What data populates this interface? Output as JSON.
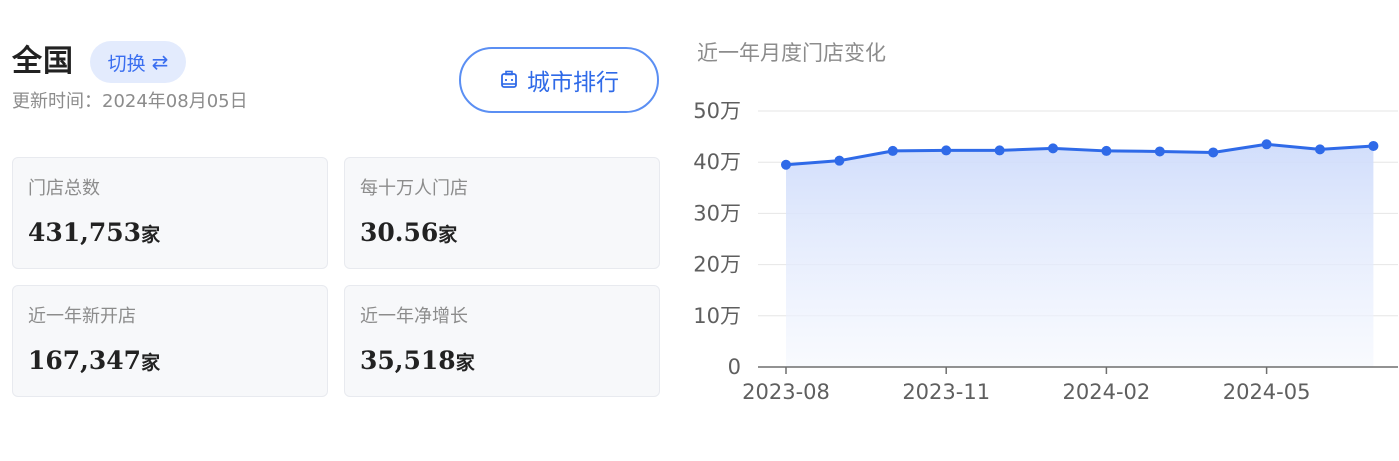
{
  "header": {
    "region": "全国",
    "switch_label": "切换",
    "switch_icon": "⇄",
    "update_text": "更新时间：2024年08月05日",
    "city_rank_label": "城市排行"
  },
  "cards": [
    {
      "label": "门店总数",
      "value": "431,753",
      "unit": "家"
    },
    {
      "label": "每十万人门店",
      "value": "30.56",
      "unit": "家"
    },
    {
      "label": "近一年新开店",
      "value": "167,347",
      "unit": "家"
    },
    {
      "label": "近一年净增长",
      "value": "35,518",
      "unit": "家"
    }
  ],
  "colors": {
    "accent": "#2f6ae8",
    "line": "#2f6ae8",
    "area_top": "#cfdcfb",
    "area_bottom": "#f4f7fe",
    "grid": "#e6e6e6"
  },
  "chart_data": {
    "type": "area",
    "title": "近一年月度门店变化",
    "xlabel": "",
    "ylabel": "",
    "x": [
      "2023-08",
      "2023-09",
      "2023-10",
      "2023-11",
      "2023-12",
      "2024-01",
      "2024-02",
      "2024-03",
      "2024-04",
      "2024-05",
      "2024-06",
      "2024-07"
    ],
    "x_tick_labels": [
      "2023-08",
      "2023-11",
      "2024-02",
      "2024-05"
    ],
    "y_tick_labels": [
      "0",
      "10万",
      "20万",
      "30万",
      "40万",
      "50万"
    ],
    "ylim": [
      0,
      500000
    ],
    "grid": true,
    "series": [
      {
        "values": [
          395000,
          403000,
          422000,
          423000,
          423000,
          427000,
          422000,
          421000,
          419000,
          435000,
          425000,
          431753
        ]
      }
    ]
  }
}
